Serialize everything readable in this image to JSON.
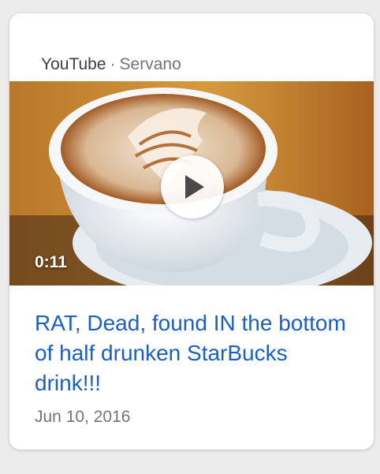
{
  "card": {
    "source_site": "YouTube",
    "separator": "·",
    "source_channel": "Servano",
    "video": {
      "duration": "0:11",
      "play_icon": "play-icon"
    },
    "title": "RAT, Dead, found IN the bottom of half drunken StarBucks drink!!!",
    "date": "Jun 10, 2016"
  },
  "colors": {
    "title_link": "#1a5fc1",
    "meta_text": "#70757a"
  }
}
